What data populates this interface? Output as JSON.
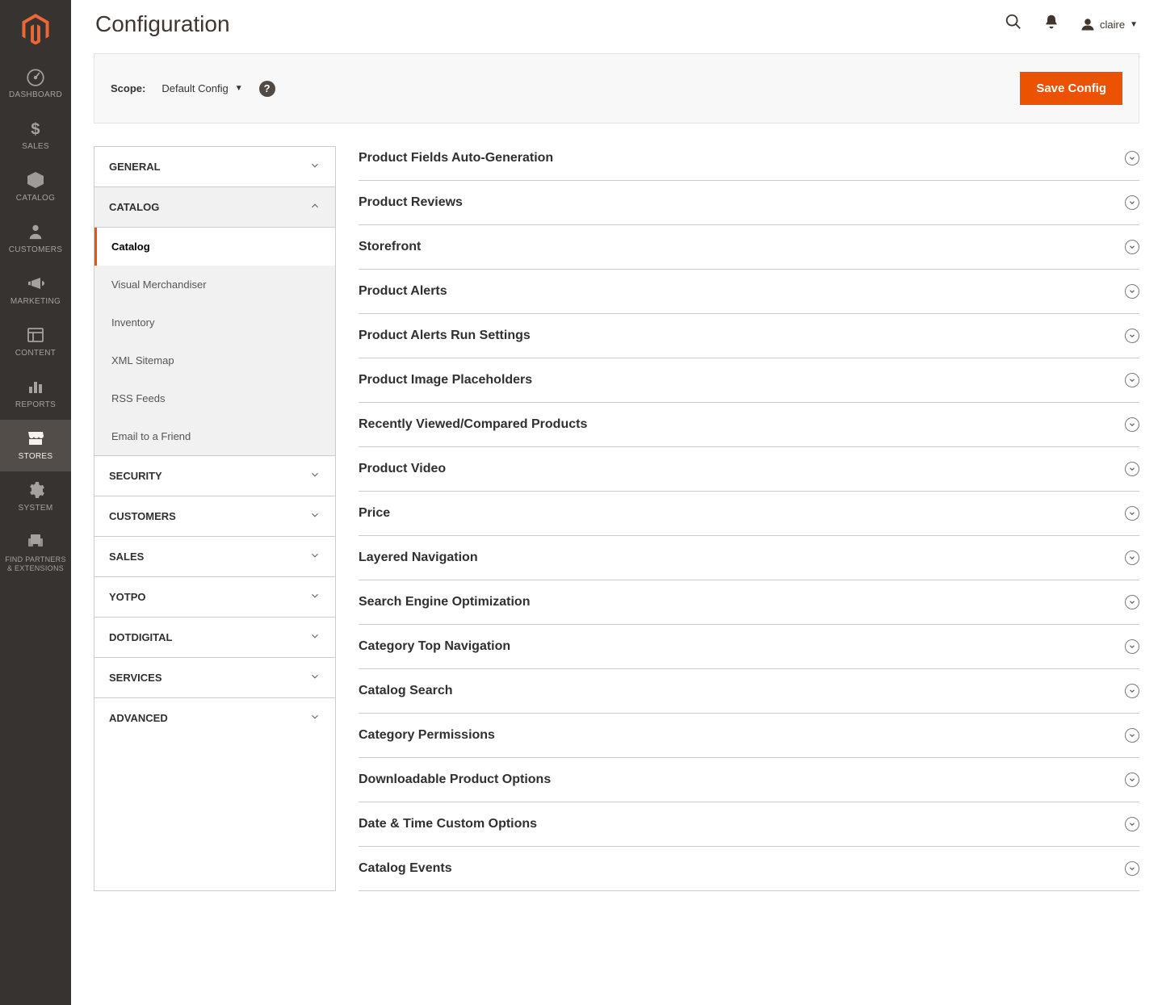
{
  "page_title": "Configuration",
  "user_name": "claire",
  "scope_label": "Scope:",
  "scope_value": "Default Config",
  "save_button_label": "Save Config",
  "sidebar_nav": [
    {
      "label": "DASHBOARD",
      "icon": "dashboard"
    },
    {
      "label": "SALES",
      "icon": "dollar"
    },
    {
      "label": "CATALOG",
      "icon": "box"
    },
    {
      "label": "CUSTOMERS",
      "icon": "person"
    },
    {
      "label": "MARKETING",
      "icon": "megaphone"
    },
    {
      "label": "CONTENT",
      "icon": "content"
    },
    {
      "label": "REPORTS",
      "icon": "reports"
    },
    {
      "label": "STORES",
      "icon": "stores",
      "active": true
    },
    {
      "label": "SYSTEM",
      "icon": "gear"
    },
    {
      "label": "FIND PARTNERS & EXTENSIONS",
      "icon": "partners",
      "small": true
    }
  ],
  "config_tabs": [
    {
      "label": "GENERAL",
      "expanded": false
    },
    {
      "label": "CATALOG",
      "expanded": true,
      "items": [
        {
          "label": "Catalog",
          "active": true
        },
        {
          "label": "Visual Merchandiser"
        },
        {
          "label": "Inventory"
        },
        {
          "label": "XML Sitemap"
        },
        {
          "label": "RSS Feeds"
        },
        {
          "label": "Email to a Friend"
        }
      ]
    },
    {
      "label": "SECURITY",
      "expanded": false
    },
    {
      "label": "CUSTOMERS",
      "expanded": false
    },
    {
      "label": "SALES",
      "expanded": false
    },
    {
      "label": "YOTPO",
      "expanded": false
    },
    {
      "label": "DOTDIGITAL",
      "expanded": false
    },
    {
      "label": "SERVICES",
      "expanded": false
    },
    {
      "label": "ADVANCED",
      "expanded": false
    }
  ],
  "config_sections": [
    "Product Fields Auto-Generation",
    "Product Reviews",
    "Storefront",
    "Product Alerts",
    "Product Alerts Run Settings",
    "Product Image Placeholders",
    "Recently Viewed/Compared Products",
    "Product Video",
    "Price",
    "Layered Navigation",
    "Search Engine Optimization",
    "Category Top Navigation",
    "Catalog Search",
    "Category Permissions",
    "Downloadable Product Options",
    "Date & Time Custom Options",
    "Catalog Events"
  ]
}
